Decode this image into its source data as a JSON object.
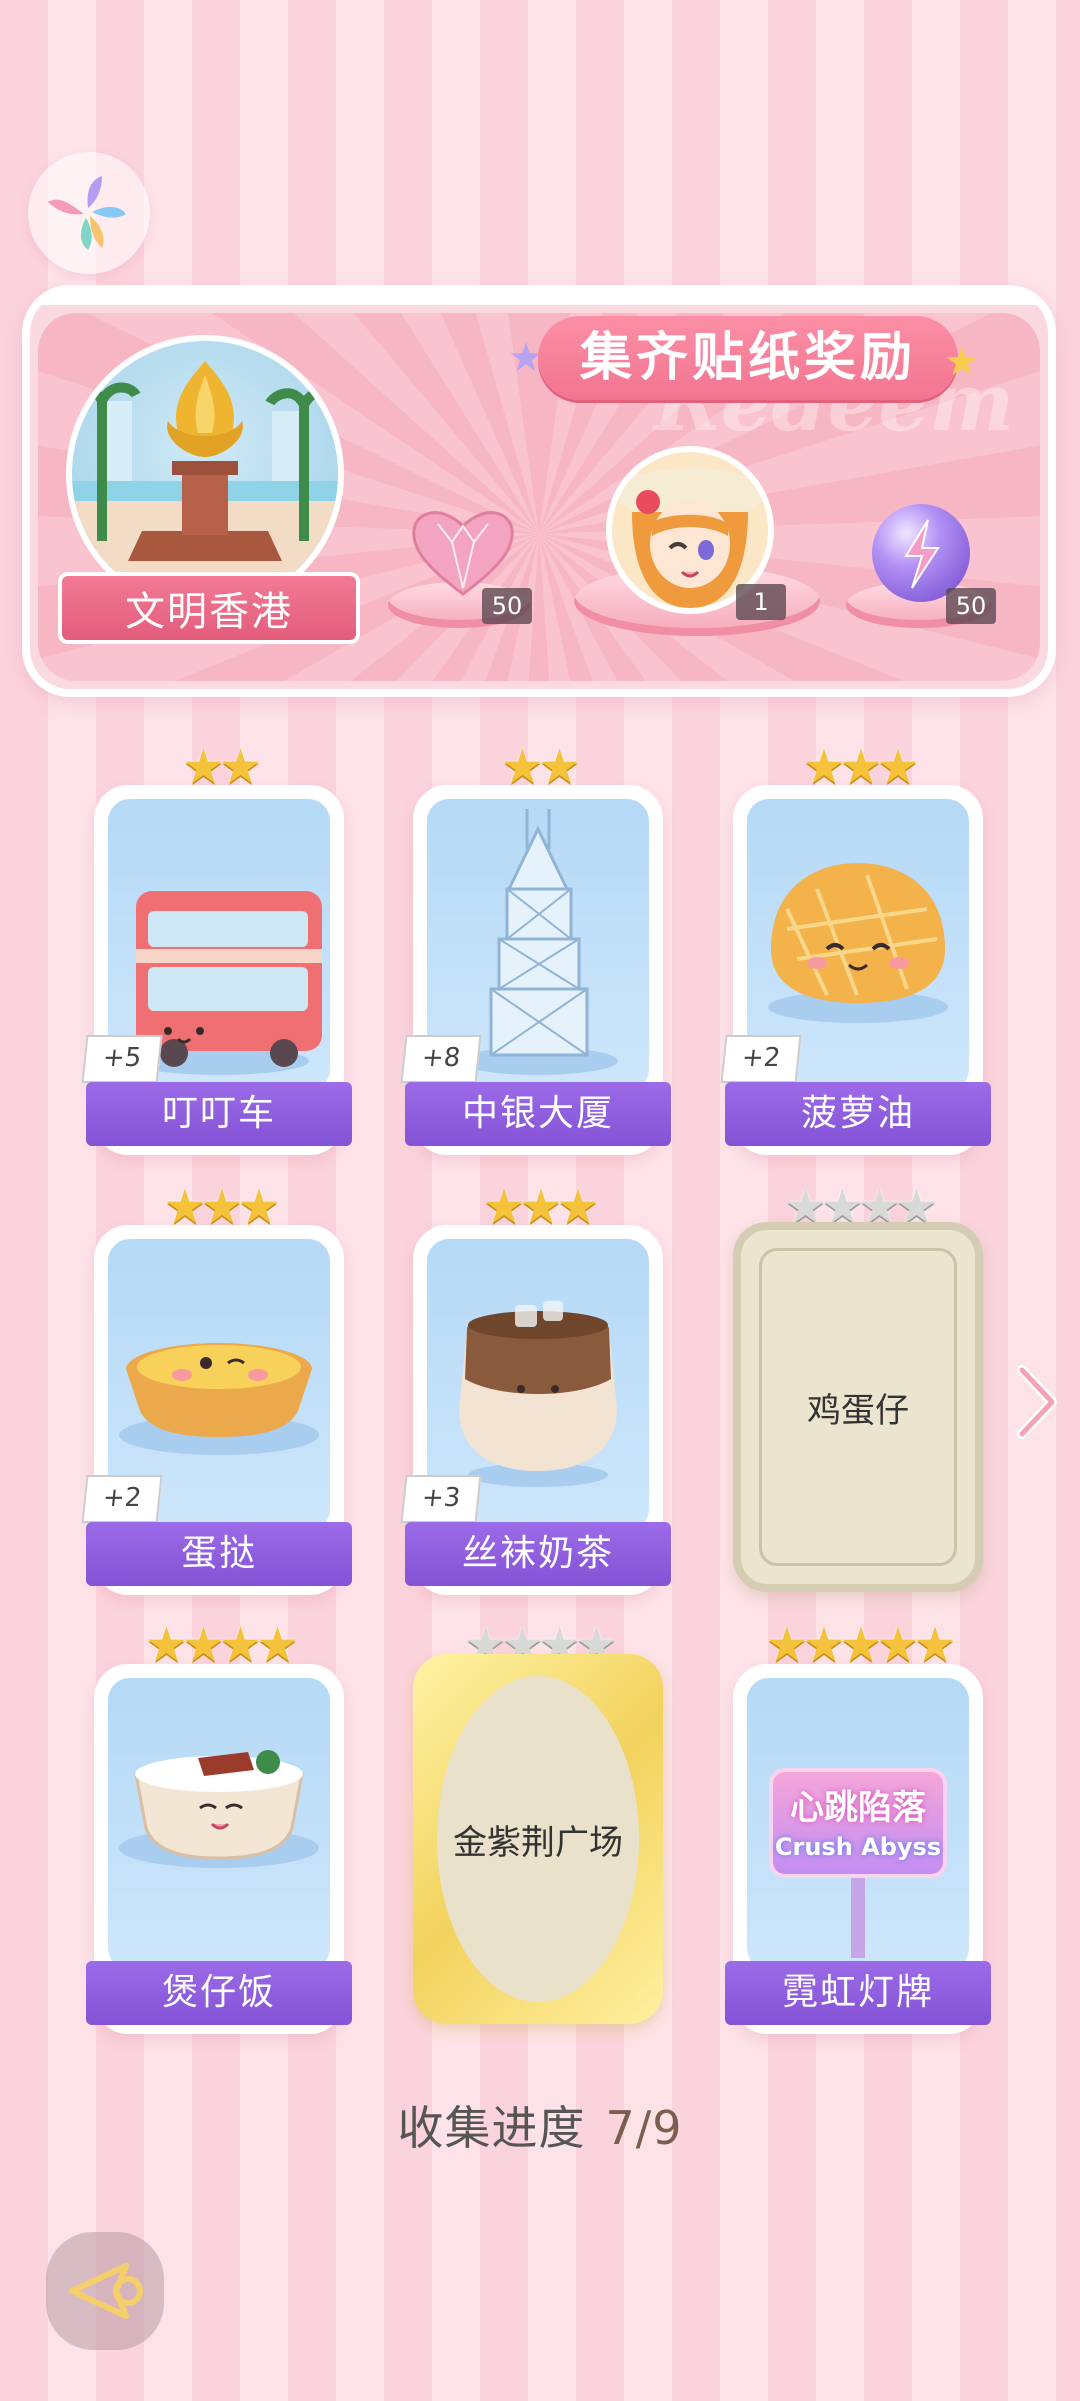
{
  "banner": {
    "title": "集齐贴纸奖励",
    "watermark": "Redeem",
    "landmark_label": "文明香港",
    "rewards": [
      {
        "icon": "pink-heart-gem-icon",
        "count": "50"
      },
      {
        "icon": "character-avatar-icon",
        "count": "1"
      },
      {
        "icon": "purple-lightning-orb-icon",
        "count": "50"
      }
    ]
  },
  "stickers": [
    {
      "name": "叮叮车",
      "stars": 2,
      "bonus": "+5",
      "collected": true,
      "art": "tram-icon"
    },
    {
      "name": "中银大厦",
      "stars": 2,
      "bonus": "+8",
      "collected": true,
      "art": "tower-icon"
    },
    {
      "name": "菠萝油",
      "stars": 3,
      "bonus": "+2",
      "collected": true,
      "art": "pineapple-bun-icon"
    },
    {
      "name": "蛋挞",
      "stars": 3,
      "bonus": "+2",
      "collected": true,
      "art": "egg-tart-icon"
    },
    {
      "name": "丝袜奶茶",
      "stars": 3,
      "bonus": "+3",
      "collected": true,
      "art": "milk-tea-icon"
    },
    {
      "name": "鸡蛋仔",
      "stars": 4,
      "bonus": "",
      "collected": false,
      "art": ""
    },
    {
      "name": "煲仔饭",
      "stars": 4,
      "bonus": "",
      "collected": true,
      "art": "claypot-rice-icon"
    },
    {
      "name": "金紫荆广场",
      "stars": 4,
      "bonus": "",
      "collected": false,
      "art": ""
    },
    {
      "name": "霓虹灯牌",
      "stars": 5,
      "bonus": "",
      "collected": true,
      "art": "neon-sign-icon",
      "neon_text_top": "心跳陷落",
      "neon_text_bottom": "Crush Abyss"
    }
  ],
  "progress": {
    "label": "收集进度",
    "value": "7/9"
  },
  "colors": {
    "accent_pink": "#f37491",
    "label_purple": "#8b5bdc",
    "star_gold": "#f5c23b"
  }
}
